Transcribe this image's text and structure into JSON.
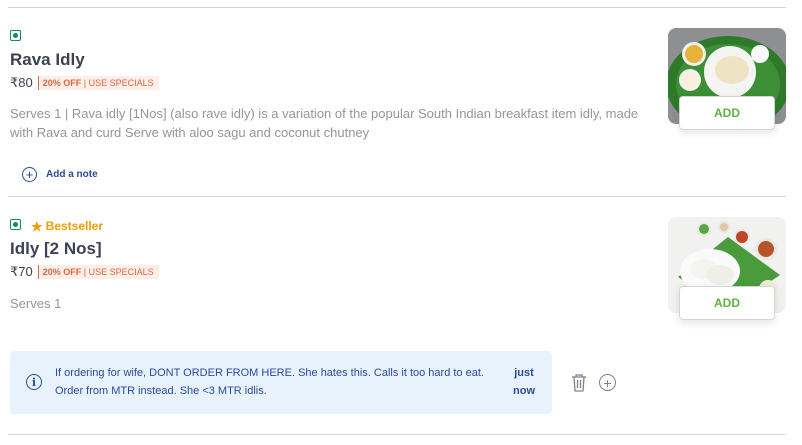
{
  "items": [
    {
      "name": "Rava Idly",
      "price": "₹80",
      "offer_pct": "20% OFF",
      "offer_text": "| USE SPECIALS",
      "description": "Serves 1 | Rava idly [1Nos] (also rave idly) is a variation of the popular South Indian breakfast item idly, made with Rava and curd Serve with aloo sagu and coconut chutney",
      "add_label": "ADD",
      "note_label": "Add a note"
    },
    {
      "badge": "Bestseller",
      "name": "Idly [2 Nos]",
      "price": "₹70",
      "offer_pct": "20% OFF",
      "offer_text": "| USE SPECIALS",
      "description": "Serves 1",
      "add_label": "ADD",
      "note": {
        "text": "If ordering for wife, DONT ORDER FROM HERE. She hates this. Calls it too hard to eat. Order from MTR instead. She <3 MTR idlis.",
        "time": "just now"
      }
    }
  ],
  "icons": {
    "veg": "veg-indicator-icon",
    "star": "star-icon",
    "add_note": "plus-circle-icon",
    "info": "info-icon",
    "delete": "trash-icon",
    "add": "plus-circle-icon"
  },
  "colors": {
    "veg_green": "#0f8a65",
    "bestseller_orange": "#ee9c00",
    "add_green": "#60b246",
    "offer_red": "#db6742",
    "note_blue": "#2a4b9b",
    "note_bg": "#e8f2fc"
  }
}
